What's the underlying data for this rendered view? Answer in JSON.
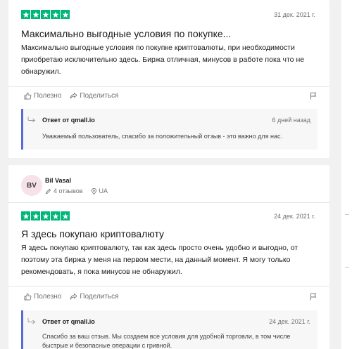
{
  "reviews": [
    {
      "rating": 5,
      "date": "31 дек. 2021 г.",
      "title": "Максимально выгодные условия по покупке...",
      "body": "Максимально выгодные условия по покупке криптовалюты, при необходимости приобретаю исключительно здесь. Биржа отличная, минусов в работе пока что не обнаружил.",
      "useful_label": "Полезно",
      "share_label": "Поделиться",
      "reply": {
        "from": "Ответ от qmall.io",
        "date": "6 дней назад",
        "text": "Уважаемый пользователь, спасибо за положительный отзыв - это важно для нас."
      }
    },
    {
      "user": {
        "initials": "BV",
        "name": "Bil Vasal",
        "reviews_count": "4 отзывов",
        "country": "UA"
      },
      "rating": 5,
      "date": "24 дек. 2021 г.",
      "title": "Я здесь покупаю криптовалюту",
      "body": "Я здесь покупаю криптовалюту, так как здесь просто очень удобно и выгодно, от поэтому эта биржа у меня на первом мести, на данный момент. Я могу только рекомендовать, я пока минусов не обнаружил.",
      "useful_label": "Полезно",
      "share_label": "Поделиться",
      "reply": {
        "from": "Ответ от qmall.io",
        "date": "24 дек. 2021 г.",
        "text": "Спасибо за ваш отзыв. Мы создаем все условия для удобной торговли, в том числе быстрые и безопасные операции с гривной."
      }
    }
  ],
  "colors": {
    "star_green": "#00b67a",
    "reply_accent": "#5a6bd8",
    "avatar_bg": "#f6e2e8"
  }
}
